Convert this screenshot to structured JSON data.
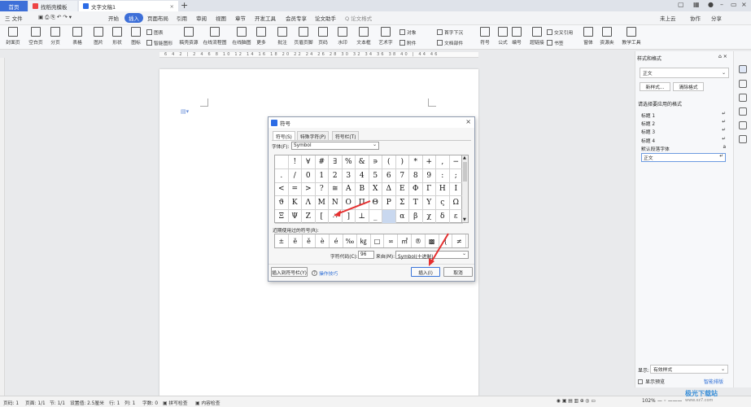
{
  "titlebar": {
    "home_tab": "首页",
    "tab1": "找稻壳模板",
    "tab2": "文字文稿1",
    "plus": "+"
  },
  "menubar": {
    "file": "三 文件",
    "items": [
      "开始",
      "插入",
      "页面布局",
      "引用",
      "审阅",
      "视图",
      "章节",
      "开发工具",
      "会员专享",
      "论文助手"
    ],
    "active_index": 1,
    "search": "Q 论文格式",
    "right": [
      "未上云",
      "协作",
      "分享"
    ]
  },
  "ribbon": {
    "big": [
      "封面页",
      "空白页",
      "分页",
      "表格",
      "图片",
      "形状",
      "图标",
      "稿壳资源",
      "在线流程图",
      "在线脑图",
      "更多",
      "批注",
      "页眉页脚",
      "页码",
      "水印",
      "文本框",
      "艺术字",
      "符号",
      "公式",
      "编号",
      "超链接",
      "书签",
      "窗体",
      "资源夹",
      "教学工具"
    ],
    "small": [
      "图表",
      "智能图形",
      "对象",
      "首字下沉",
      "附件",
      "日期",
      "文档部件",
      "交叉引用"
    ]
  },
  "ruler": {
    "marks": "6 4 2 | 2 4 6 8 10 12 14 16 18 20 22 24 26 28 30 32 34 36 38 40 | 44 46"
  },
  "dialog": {
    "title": "符号",
    "tabs": [
      "符号(S)",
      "特殊字符(P)",
      "符号栏(T)"
    ],
    "font_label": "字体(F):",
    "font_value": "Symbol",
    "symbols": [
      [
        "",
        "!",
        "∀",
        "#",
        "∃",
        "%",
        "&",
        "∍",
        "(",
        ")",
        "*",
        "+",
        ",",
        "−"
      ],
      [
        ".",
        "/",
        "0",
        "1",
        "2",
        "3",
        "4",
        "5",
        "6",
        "7",
        "8",
        "9",
        ":",
        ";"
      ],
      [
        "<",
        "=",
        ">",
        "?",
        "≅",
        "Α",
        "Β",
        "Χ",
        "Δ",
        "Ε",
        "Φ",
        "Γ",
        "Η",
        "Ι"
      ],
      [
        "ϑ",
        "Κ",
        "Λ",
        "Μ",
        "Ν",
        "Ο",
        "Π",
        "Θ",
        "Ρ",
        "Σ",
        "Τ",
        "Υ",
        "ς",
        "Ω"
      ],
      [
        "Ξ",
        "Ψ",
        "Ζ",
        "[",
        "∴",
        "]",
        "⊥",
        "_",
        "",
        "α",
        "β",
        "χ",
        "δ",
        "ε"
      ]
    ],
    "selected": [
      4,
      8
    ],
    "recent_label": "近期使用过的符号(R):",
    "recent": [
      "±",
      "ĕ",
      "ě",
      "è",
      "é",
      "‰",
      "㎏",
      "□",
      "∞",
      "㎡",
      "®",
      "▩",
      "{",
      "≠"
    ],
    "code_label": "字符代码(C):",
    "code_value": "96",
    "from_label": "来自(M):",
    "from_value": "Symbol(十进制)",
    "btn_insert_bar": "插入到符号栏(Y)",
    "tip": "操作技巧",
    "btn_insert": "插入(I)",
    "btn_cancel": "取消"
  },
  "panel": {
    "title": "样式和格式",
    "current": "正文",
    "new_btn": "新样式...",
    "clear_btn": "清除格式",
    "apply_label": "请选择要应用的格式",
    "styles": [
      "标题 1",
      "标题 2",
      "标题 3",
      "标题 4",
      "默认段落字体",
      "正文"
    ],
    "show_label": "显示:",
    "show_value": "有效样式",
    "preview": "显示预览",
    "smart": "智能排版"
  },
  "status": {
    "page": "页码: 1",
    "pages": "页面: 1/1",
    "section": "节: 1/1",
    "setting": "设置值: 2.5厘米",
    "row": "行: 1",
    "col": "列: 1",
    "words": "字数: 0",
    "spell": "拼写检查",
    "content": "内容检查",
    "zoom": "102%"
  },
  "watermark": {
    "main": "极光下载站",
    "sub": "www.xz7.com"
  }
}
